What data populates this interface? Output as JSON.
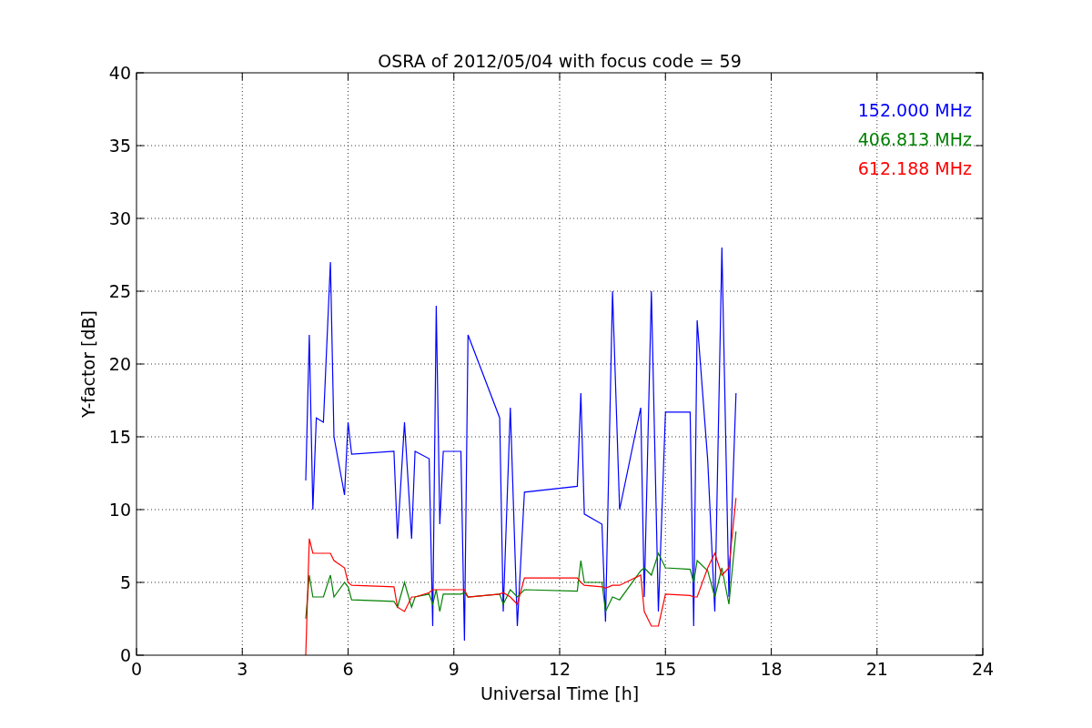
{
  "chart_data": {
    "type": "line",
    "title": "OSRA of 2012/05/04 with focus code = 59",
    "xlabel": "Universal Time [h]",
    "ylabel": "Y-factor [dB]",
    "x": [
      4.8,
      4.9,
      5.0,
      5.1,
      5.3,
      5.5,
      5.6,
      5.9,
      6.0,
      6.1,
      7.3,
      7.4,
      7.6,
      7.8,
      7.9,
      8.3,
      8.4,
      8.5,
      8.6,
      8.7,
      9.2,
      9.3,
      9.4,
      10.3,
      10.4,
      10.6,
      10.8,
      11.0,
      12.5,
      12.6,
      12.7,
      13.2,
      13.3,
      13.5,
      13.7,
      14.3,
      14.4,
      14.6,
      14.8,
      15.0,
      15.7,
      15.8,
      15.9,
      16.2,
      16.4,
      16.6,
      16.8,
      17.0
    ],
    "series": [
      {
        "name": "152.000 MHz",
        "color": "#0000ff",
        "values": [
          12,
          22,
          10,
          16.3,
          16,
          27,
          15,
          11,
          16,
          13.8,
          14,
          8,
          16,
          8,
          14,
          13.5,
          2,
          24,
          9,
          14,
          14,
          1,
          22,
          16.3,
          3,
          17,
          2,
          11.2,
          11.6,
          18,
          9.7,
          9,
          2.3,
          25,
          10,
          17,
          4,
          25,
          3,
          16.7,
          16.7,
          2,
          23,
          13.4,
          3,
          28,
          4,
          18
        ]
      },
      {
        "name": "406.813 MHz",
        "color": "#008000",
        "values": [
          2.5,
          5.5,
          4,
          4,
          4,
          5.5,
          4,
          5,
          4.7,
          3.8,
          3.7,
          3.3,
          5,
          3.3,
          4,
          4.2,
          3.5,
          4.5,
          3,
          4.2,
          4.2,
          4.3,
          4,
          4.2,
          3.5,
          4.5,
          4,
          4.5,
          4.4,
          6.5,
          5,
          5,
          3,
          4,
          3.8,
          5.8,
          6,
          5.5,
          7,
          6,
          5.9,
          5,
          6.5,
          5.8,
          4,
          6,
          3.5,
          8.5
        ]
      },
      {
        "name": "612.188 MHz",
        "color": "#ff0000",
        "values": [
          0,
          8,
          7,
          7,
          7,
          7,
          6.5,
          6,
          5,
          4.8,
          4.7,
          3.3,
          3,
          4,
          4,
          4.3,
          4.5,
          4.5,
          4.5,
          4.5,
          4.5,
          4.5,
          4,
          4.2,
          4.3,
          4,
          3.5,
          5.3,
          5.3,
          5,
          4.8,
          4.7,
          4.6,
          4.8,
          4.8,
          5.5,
          3,
          2,
          2,
          4.2,
          4.1,
          4,
          4,
          6,
          7,
          5.5,
          6,
          10.8
        ]
      }
    ],
    "grid": true,
    "xlim": [
      0,
      24
    ],
    "ylim": [
      0,
      40
    ],
    "xticks": [
      0,
      3,
      6,
      9,
      12,
      15,
      18,
      21,
      24
    ],
    "yticks": [
      0,
      5,
      10,
      15,
      20,
      25,
      30,
      35,
      40
    ]
  }
}
